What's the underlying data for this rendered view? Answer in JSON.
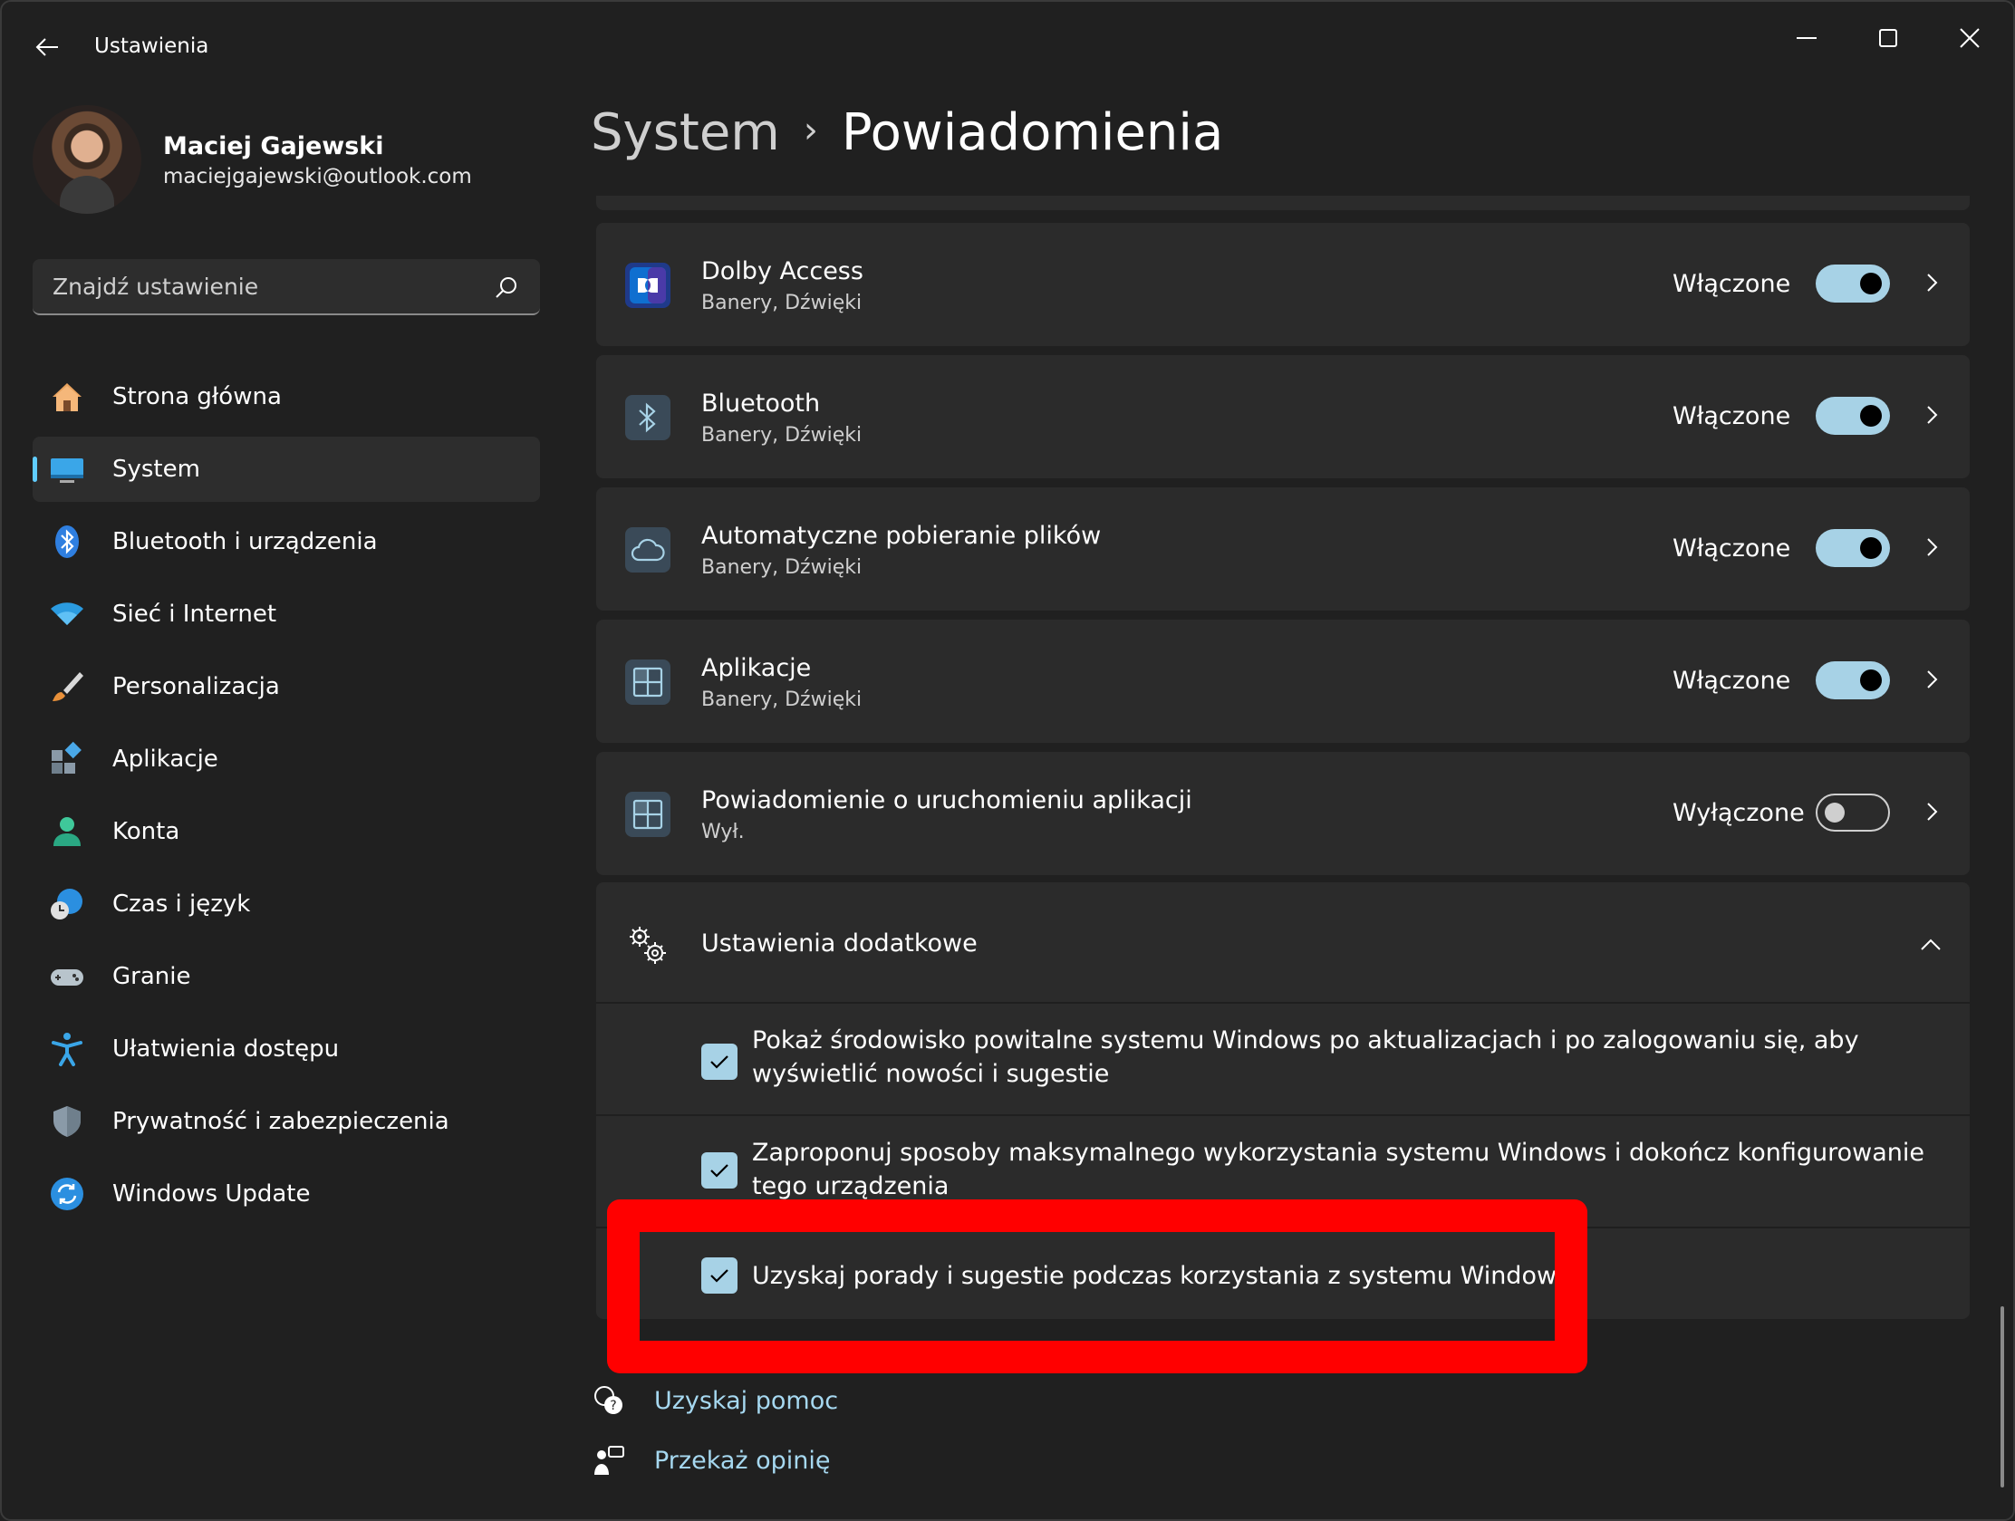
{
  "window": {
    "title": "Ustawienia",
    "controls": [
      "minimize",
      "maximize",
      "close"
    ]
  },
  "profile": {
    "name": "Maciej Gajewski",
    "email": "maciejgajewski@outlook.com"
  },
  "search": {
    "placeholder": "Znajdź ustawienie"
  },
  "nav": {
    "items": [
      {
        "label": "Strona główna",
        "icon": "home-icon"
      },
      {
        "label": "System",
        "icon": "monitor-icon",
        "active": true
      },
      {
        "label": "Bluetooth i urządzenia",
        "icon": "bluetooth-icon"
      },
      {
        "label": "Sieć i Internet",
        "icon": "wifi-icon"
      },
      {
        "label": "Personalizacja",
        "icon": "brush-icon"
      },
      {
        "label": "Aplikacje",
        "icon": "apps-icon"
      },
      {
        "label": "Konta",
        "icon": "person-icon"
      },
      {
        "label": "Czas i język",
        "icon": "globe-clock-icon"
      },
      {
        "label": "Granie",
        "icon": "gamepad-icon"
      },
      {
        "label": "Ułatwienia dostępu",
        "icon": "accessibility-icon"
      },
      {
        "label": "Prywatność i zabezpieczenia",
        "icon": "shield-icon"
      },
      {
        "label": "Windows Update",
        "icon": "update-icon"
      }
    ]
  },
  "breadcrumb": {
    "parent": "System",
    "separator": "›",
    "current": "Powiadomienia"
  },
  "apps": [
    {
      "title": "Dolby Access",
      "subtitle": "Banery, Dźwięki",
      "state": "Włączone",
      "on": true,
      "icon": "dolby-icon"
    },
    {
      "title": "Bluetooth",
      "subtitle": "Banery, Dźwięki",
      "state": "Włączone",
      "on": true,
      "icon": "bluetooth-icon"
    },
    {
      "title": "Automatyczne pobieranie plików",
      "subtitle": "Banery, Dźwięki",
      "state": "Włączone",
      "on": true,
      "icon": "cloud-icon"
    },
    {
      "title": "Aplikacje",
      "subtitle": "Banery, Dźwięki",
      "state": "Włączone",
      "on": true,
      "icon": "app-grid-icon"
    },
    {
      "title": "Powiadomienie o uruchomieniu aplikacji",
      "subtitle": "Wył.",
      "state": "Wyłączone",
      "on": false,
      "icon": "app-grid-icon"
    }
  ],
  "additional": {
    "title": "Ustawienia dodatkowe",
    "expanded": true,
    "options": [
      {
        "text": "Pokaż środowisko powitalne systemu Windows po aktualizacjach i po zalogowaniu się, aby wyświetlić nowości i sugestie",
        "checked": true
      },
      {
        "text": "Zaproponuj sposoby maksymalnego wykorzystania systemu Windows i dokończ konfigurowanie tego urządzenia",
        "checked": true
      },
      {
        "text": "Uzyskaj porady i sugestie podczas korzystania z systemu Windows",
        "checked": true
      }
    ]
  },
  "footer": {
    "help": "Uzyskaj pomoc",
    "feedback": "Przekaż opinię"
  },
  "colors": {
    "accent": "#60cdff",
    "toggle_on": "#a7d2e6",
    "highlight": "#ff0000",
    "link": "#a6d8f0"
  }
}
